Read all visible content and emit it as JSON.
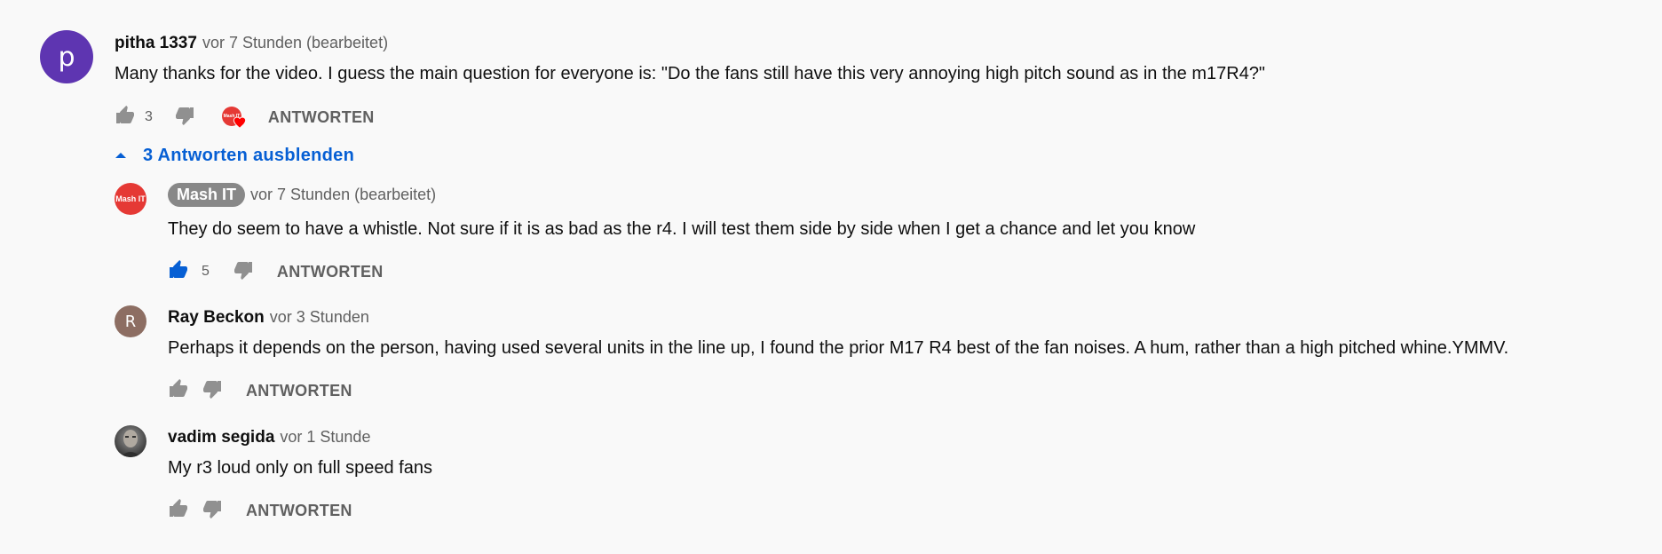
{
  "colors": {
    "accent": "#065fd4",
    "main_avatar": "#5e35b1",
    "mashit_avatar": "#e53935",
    "ray_avatar": "#8d6e63",
    "heart": "#ff0000"
  },
  "main_comment": {
    "avatar_letter": "p",
    "author": "pitha 1337",
    "time": "vor 7 Stunden (bearbeitet)",
    "text": "Many thanks for the video. I guess the main question for everyone is: \"Do the fans still have this very annoying high pitch sound as in the m17R4?\"",
    "likes": "3",
    "reply_label": "ANTWORTEN",
    "creator_heart_avatar_text": "Mash IT"
  },
  "toggle_replies": {
    "label": "3 Antworten ausblenden",
    "icon": "caret-up-icon"
  },
  "replies": [
    {
      "avatar_text": "Mash IT",
      "author": "Mash IT",
      "time": "vor 7 Stunden (bearbeitet)",
      "text": "They do seem to have a whistle. Not sure if it is as bad as the r4. I will test them side by side when I get a chance and let you know",
      "likes": "5",
      "reply_label": "ANTWORTEN"
    },
    {
      "avatar_letter": "R",
      "author": "Ray Beckon",
      "time": "vor 3 Stunden",
      "text": "Perhaps it depends on the person, having used several units in the line up, I found the prior M17 R4 best of the fan noises. A hum, rather than a high pitched whine.YMMV.",
      "reply_label": "ANTWORTEN"
    },
    {
      "author": "vadim segida",
      "time": "vor 1 Stunde",
      "text": "My r3 loud only on full speed fans",
      "reply_label": "ANTWORTEN"
    }
  ]
}
